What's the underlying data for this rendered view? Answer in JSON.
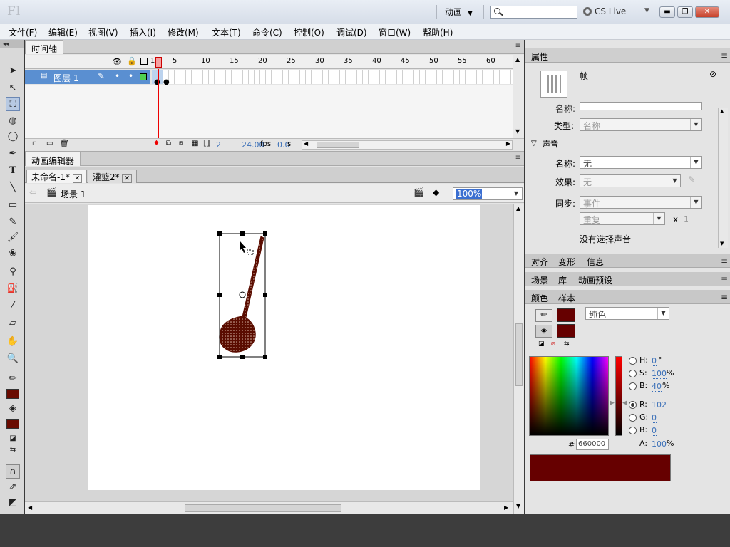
{
  "app": {
    "logo": "Fl",
    "workspace": "动画",
    "cs_live": "CS Live"
  },
  "window_controls": {
    "minimize": "▬",
    "restore": "❐",
    "close": "✕"
  },
  "menu": [
    "文件(F)",
    "编辑(E)",
    "视图(V)",
    "插入(I)",
    "修改(M)",
    "文本(T)",
    "命令(C)",
    "控制(O)",
    "调试(D)",
    "窗口(W)",
    "帮助(H)"
  ],
  "timeline": {
    "tab": "时间轴",
    "frame_numbers": [
      "1",
      "5",
      "10",
      "15",
      "20",
      "25",
      "30",
      "35",
      "40",
      "45",
      "50",
      "55",
      "60"
    ],
    "layer_name": "图层 1",
    "current_frame": "2",
    "fps": "24.00",
    "fps_unit": "fps",
    "time": "0.0",
    "time_unit": "s"
  },
  "motion_editor": {
    "tab": "动画编辑器"
  },
  "documents": [
    {
      "name": "未命名-1*"
    },
    {
      "name": "灌篮2*"
    }
  ],
  "scene": {
    "label": "场景 1",
    "zoom": "100%"
  },
  "properties": {
    "tab": "属性",
    "type_label": "帧",
    "name_label": "名称:",
    "kind_label": "类型:",
    "kind_value": "名称",
    "sound_section": "声音",
    "sound_name_label": "名称:",
    "sound_name_value": "无",
    "effect_label": "效果:",
    "effect_value": "无",
    "sync_label": "同步:",
    "sync_value": "事件",
    "repeat_value": "重复",
    "repeat_x": "x",
    "repeat_count": "1",
    "no_sound": "没有选择声音"
  },
  "panel_tabs_1": [
    "对齐",
    "变形",
    "信息"
  ],
  "panel_tabs_2": [
    "场景",
    "库",
    "动画预设"
  ],
  "color_panel": {
    "tabs": [
      "颜色",
      "样本"
    ],
    "fill_type": "纯色",
    "hex_label": "#",
    "hex_value": "660000",
    "H_label": "H:",
    "H_value": "0",
    "H_unit": "°",
    "S_label": "S:",
    "S_value": "100",
    "S_unit": "%",
    "B_label": "B:",
    "B_value": "40",
    "B_unit": "%",
    "R_label": "R:",
    "R_value": "102",
    "G_label": "G:",
    "G_value": "0",
    "Bl_label": "B:",
    "Bl_value": "0",
    "A_label": "A:",
    "A_value": "100",
    "A_unit": "%",
    "swatch_color": "#660000"
  }
}
